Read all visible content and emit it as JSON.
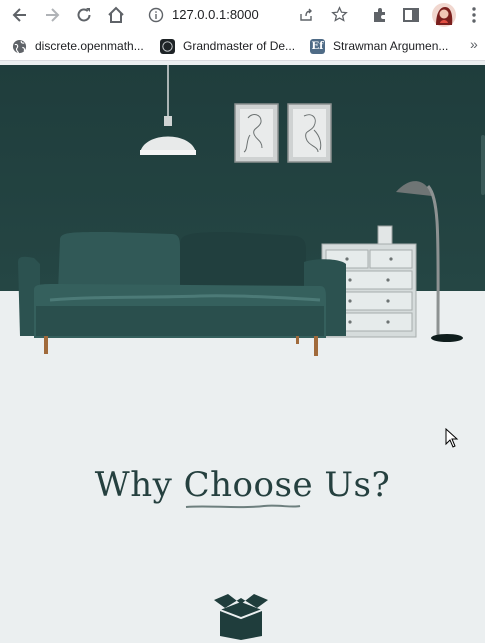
{
  "browser": {
    "url": "127.0.0.1:8000",
    "bookmarks": [
      {
        "label": "discrete.openmath...",
        "icon": "globe-icon"
      },
      {
        "label": "Grandmaster of De...",
        "icon": "site-logo-icon"
      },
      {
        "label": "Strawman Argumen...",
        "icon": "ef-logo-icon"
      }
    ],
    "overflow_label": "»"
  },
  "hero": {
    "wall_color": "#1f3d3c",
    "sofa_color": "#2f5452",
    "floor_color": "#ebeff0"
  },
  "section": {
    "heading_before": "Why ",
    "heading_accent": "Choose",
    "heading_after": " Us?",
    "icon": "open-box-icon"
  },
  "colors": {
    "heading": "#25403f",
    "accent": "#1f3d3c"
  }
}
